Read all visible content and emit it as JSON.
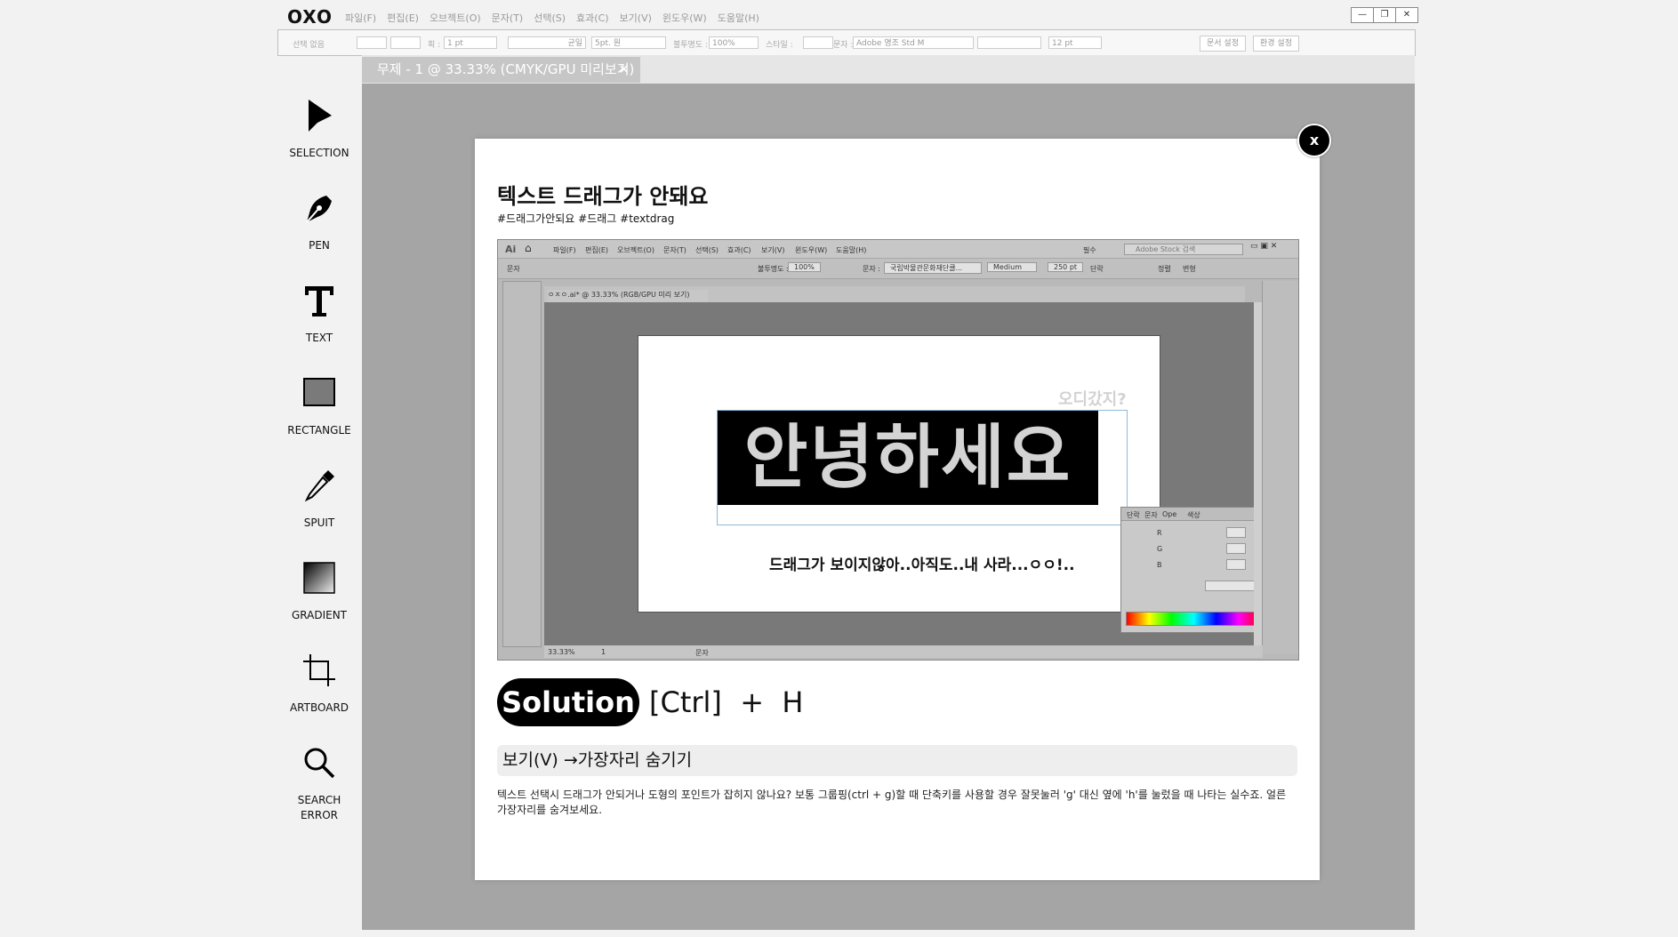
{
  "app": {
    "logo": "OXO",
    "menu": [
      "파일(F)",
      "편집(E)",
      "오브젝트(O)",
      "문자(T)",
      "선택(S)",
      "효과(C)",
      "보기(V)",
      "윈도우(W)",
      "도움말(H)"
    ],
    "window_controls": [
      "—",
      "❐",
      "✕"
    ]
  },
  "options_bar": {
    "selection": "선택 없음",
    "stroke_label": "획 :",
    "stroke_value": "1 pt",
    "stroke_style": "균일",
    "brush": "5pt. 원",
    "opacity_label": "불투명도 :",
    "opacity_value": "100%",
    "style_label": "스타일 :",
    "font_label": "문자 :",
    "font_value": "Adobe 명조 Std M",
    "size_value": "12 pt",
    "doc_setup": "문서 설정",
    "preferences": "환경 설정"
  },
  "document_tab": {
    "title": "무제 - 1 @ 33.33% (CMYK/GPU 미리보기)",
    "close": "✕"
  },
  "tools": [
    {
      "name": "selection-tool",
      "label": "SELECTION",
      "icon": "selection-arrow-icon"
    },
    {
      "name": "pen-tool",
      "label": "PEN",
      "icon": "pen-icon"
    },
    {
      "name": "text-tool",
      "label": "TEXT",
      "icon": "text-t-icon"
    },
    {
      "name": "rectangle-tool",
      "label": "RECTANGLE",
      "icon": "rectangle-icon"
    },
    {
      "name": "spuit-tool",
      "label": "SPUIT",
      "icon": "eyedropper-icon"
    },
    {
      "name": "gradient-tool",
      "label": "GRADIENT",
      "icon": "gradient-icon"
    },
    {
      "name": "artboard-tool",
      "label": "ARTBOARD",
      "icon": "artboard-icon"
    },
    {
      "name": "search-error-tool",
      "label": "SEARCH\nERROR",
      "icon": "search-icon"
    }
  ],
  "modal": {
    "close": "x",
    "title": "텍스트 드래그가 안돼요",
    "tags": "#드래그가안되요 #드래그 #textdrag",
    "screenshot": {
      "ai_logo": "Ai",
      "menu": [
        "파일(F)",
        "편집(E)",
        "오브젝트(O)",
        "문자(T)",
        "선택(S)",
        "효과(C)",
        "보기(V)",
        "윈도우(W)",
        "도움말(H)"
      ],
      "essentials": "필수",
      "stock_search": "Adobe Stock 검색",
      "ctrl_label": "문자",
      "opacity_label": "불투명도 :",
      "opacity_value": "100%",
      "font_label": "문자 :",
      "font_value": "국립박물관문화재단클...",
      "weight": "Medium",
      "size": "250 pt",
      "para_label": "단락",
      "align_label": "정렬",
      "transform_label": "변형",
      "doc_tab": "ㅇㅈㅇ.ai* @ 33.33% (RGB/GPU 미리 보기)",
      "hello": "안녕하세요",
      "where": "오디갔지?",
      "drag_text": "드래그가 보이지않아..아직도..내 사라...ㅇㅇ!..",
      "color_tabs": [
        "단락",
        "문자",
        "Ope",
        "색상"
      ],
      "color_channels": [
        "R",
        "G",
        "B"
      ],
      "zoom": "33.33%",
      "page": "1",
      "status": "문자"
    },
    "solution_label": "Solution",
    "shortcut": "[Ctrl]  +  H",
    "menu_path": "보기(V) →가장자리 숨기기",
    "description": "텍스트 선택시 드래그가 안되거나 도형의 포인트가 잡히지 않나요? 보통 그룹핑(ctrl + g)할 때 단축키를 사용할 경우 잘못눌러 'g' 대신 옆에 'h'를 눌렀을 때 나타는 실수죠. 얼른 가장자리를 숨겨보세요."
  }
}
